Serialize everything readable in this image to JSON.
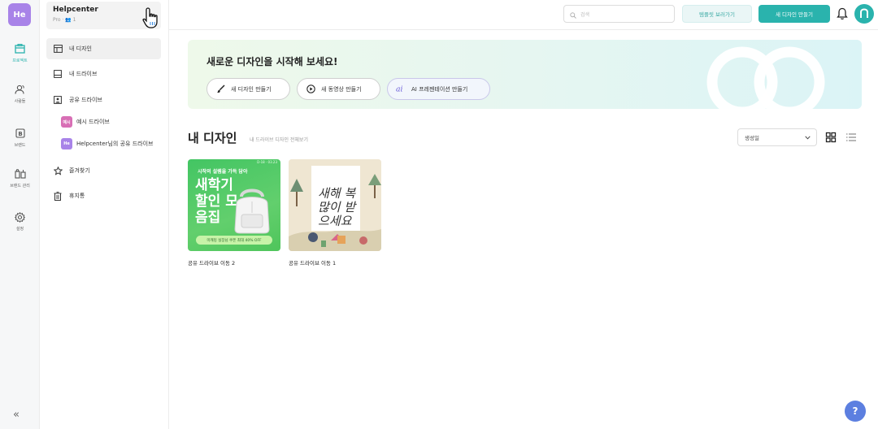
{
  "rail": {
    "logo": "He",
    "items": [
      {
        "label": "프로젝트",
        "icon": "folder-icon"
      },
      {
        "label": "사람들",
        "icon": "people-icon"
      },
      {
        "label": "브랜드",
        "icon": "brand-icon"
      },
      {
        "label": "브랜드 관리",
        "icon": "brand-manage-icon"
      },
      {
        "label": "설정",
        "icon": "gear-icon"
      }
    ],
    "collapse": "«"
  },
  "workspace": {
    "name": "Helpcenter",
    "meta": "Pro · 👥 1"
  },
  "sidebar": {
    "items": [
      {
        "label": "내 디자인"
      },
      {
        "label": "내 드라이브"
      },
      {
        "label": "공유 드라이브"
      },
      {
        "label": "즐겨찾기"
      },
      {
        "label": "휴지통"
      }
    ],
    "sub_items": [
      {
        "badge": "예시",
        "label": "예시 드라이브",
        "color": "#d86fb5"
      },
      {
        "badge": "He",
        "label": "Helpcenter님의 공유 드라이브",
        "color": "#a883e8"
      }
    ]
  },
  "topbar": {
    "search_placeholder": "검색",
    "template_button": "템플릿 보러가기",
    "new_design_button": "새 디자인 만들기"
  },
  "hero": {
    "title": "새로운 디자인을 시작해 보세요!",
    "buttons": [
      {
        "label": "새 디자인 만들기",
        "icon": "brush-icon"
      },
      {
        "label": "새 동영상 만들기",
        "icon": "play-icon"
      },
      {
        "label": "AI 프레젠테이션 만들기",
        "icon": "ai-icon"
      }
    ]
  },
  "section": {
    "title": "내 디자인",
    "link": "내 드라이브 디자인 전체보기",
    "sort": "생성일"
  },
  "cards": [
    {
      "title": "공유 드라이브 이동 2",
      "thumb_top": "시작의 설렘을 가득 담아",
      "thumb_tag": "D-18 · 03.23",
      "thumb_big": "새학기 할인 모음집",
      "thumb_pill": "미캐밍 실장님 쿠폰 최대 40% OFF"
    },
    {
      "title": "공유 드라이브 이동 1",
      "thumb_calligraphy": "새해 복 많이 받으세요",
      "thumb_sub": "새해 복 많이 받으세요"
    }
  ],
  "help": "?",
  "colors": {
    "accent": "#2ab3ad",
    "workspace_logo": "#a883e8",
    "help": "#5c7fe0"
  }
}
